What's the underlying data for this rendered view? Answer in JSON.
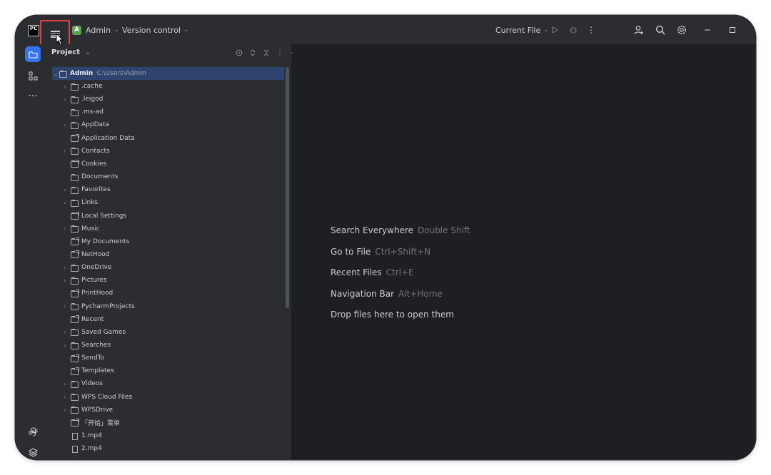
{
  "titlebar": {
    "project_initial": "A",
    "project_name": "Admin",
    "vcs_label": "Version control",
    "run_config": "Current File"
  },
  "sidebar": {
    "title": "Project"
  },
  "tree": {
    "root": {
      "name": "Admin",
      "path": "C:\\Users\\Admin"
    },
    "items": [
      {
        "label": ".cache",
        "kind": "folder",
        "expandable": true
      },
      {
        "label": ".leigod",
        "kind": "folder",
        "expandable": true
      },
      {
        "label": ".ms-ad",
        "kind": "folder",
        "expandable": false
      },
      {
        "label": "AppData",
        "kind": "folder",
        "expandable": true
      },
      {
        "label": "Application Data",
        "kind": "link",
        "expandable": false
      },
      {
        "label": "Contacts",
        "kind": "folder",
        "expandable": true
      },
      {
        "label": "Cookies",
        "kind": "link",
        "expandable": false
      },
      {
        "label": "Documents",
        "kind": "folder",
        "expandable": false
      },
      {
        "label": "Favorites",
        "kind": "folder",
        "expandable": true
      },
      {
        "label": "Links",
        "kind": "folder",
        "expandable": true
      },
      {
        "label": "Local Settings",
        "kind": "link",
        "expandable": false
      },
      {
        "label": "Music",
        "kind": "folder",
        "expandable": true
      },
      {
        "label": "My Documents",
        "kind": "link",
        "expandable": false
      },
      {
        "label": "NetHood",
        "kind": "link",
        "expandable": false
      },
      {
        "label": "OneDrive",
        "kind": "folder",
        "expandable": true
      },
      {
        "label": "Pictures",
        "kind": "folder",
        "expandable": true
      },
      {
        "label": "PrintHood",
        "kind": "link",
        "expandable": false
      },
      {
        "label": "PycharmProjects",
        "kind": "folder",
        "expandable": true
      },
      {
        "label": "Recent",
        "kind": "link",
        "expandable": false
      },
      {
        "label": "Saved Games",
        "kind": "folder",
        "expandable": true
      },
      {
        "label": "Searches",
        "kind": "folder",
        "expandable": true
      },
      {
        "label": "SendTo",
        "kind": "link",
        "expandable": false
      },
      {
        "label": "Templates",
        "kind": "link",
        "expandable": false
      },
      {
        "label": "Videos",
        "kind": "folder",
        "expandable": true
      },
      {
        "label": "WPS Cloud Files",
        "kind": "folder",
        "expandable": true
      },
      {
        "label": "WPSDrive",
        "kind": "folder",
        "expandable": true
      },
      {
        "label": "「开始」菜单",
        "kind": "link",
        "expandable": false
      },
      {
        "label": "1.mp4",
        "kind": "file",
        "expandable": false
      },
      {
        "label": "2.mp4",
        "kind": "file",
        "expandable": false
      }
    ]
  },
  "editor": {
    "hints": [
      {
        "action": "Search Everywhere",
        "shortcut": "Double Shift"
      },
      {
        "action": "Go to File",
        "shortcut": "Ctrl+Shift+N"
      },
      {
        "action": "Recent Files",
        "shortcut": "Ctrl+E"
      },
      {
        "action": "Navigation Bar",
        "shortcut": "Alt+Home"
      },
      {
        "action": "Drop files here to open them",
        "shortcut": ""
      }
    ]
  },
  "colors": {
    "accent": "#3574f0",
    "highlight_box": "#e24040",
    "selection": "#2e436e"
  }
}
